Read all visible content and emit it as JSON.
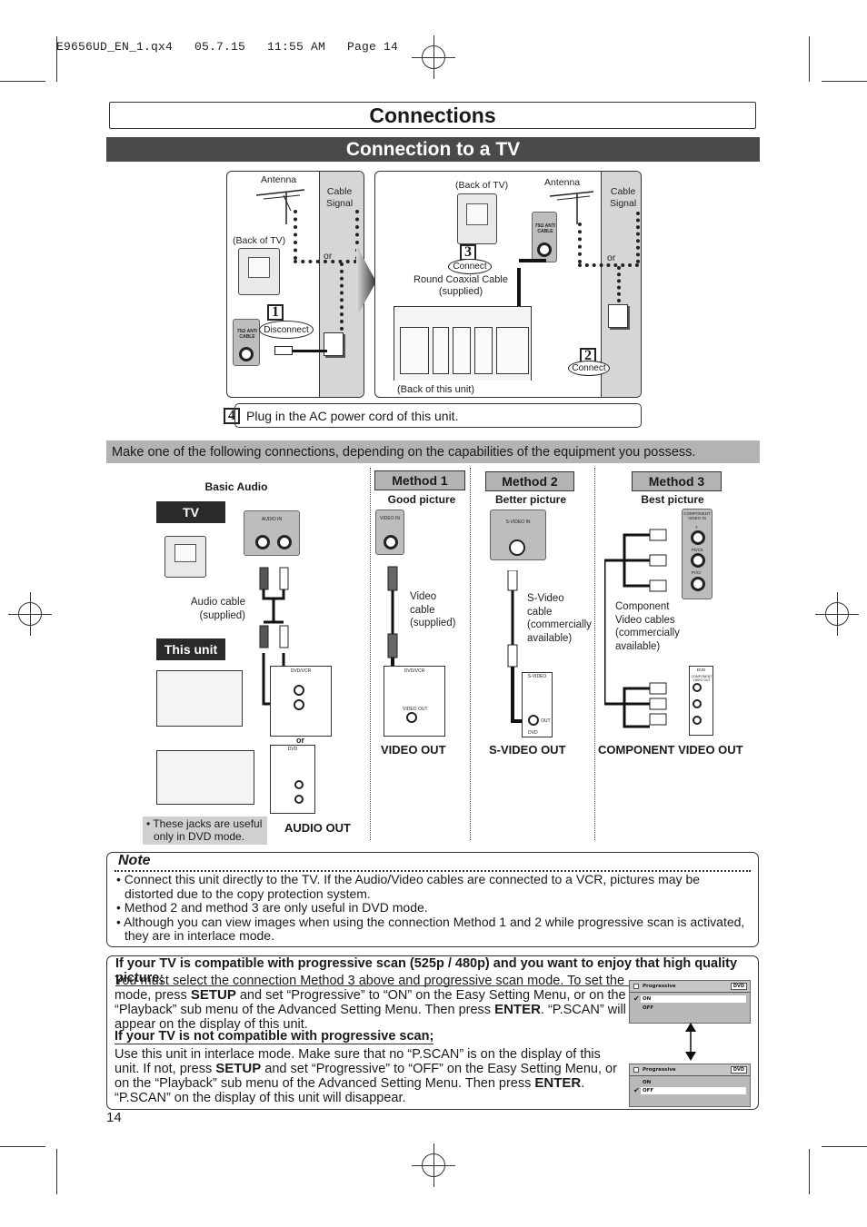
{
  "slug": "E9656UD_EN_1.qx4   05.7.15   11:55 AM   Page 14",
  "header": {
    "title": "Connections",
    "section_title": "Connection to a TV"
  },
  "diagram_top": {
    "left_panel": {
      "antenna": "Antenna",
      "cable_signal_1": "Cable",
      "cable_signal_2": "Signal",
      "back_of_tv": "(Back of TV)",
      "or": "or",
      "jack_label": "75Ω ANT/ CABLE",
      "step_number": "1",
      "step_action": "Disconnect"
    },
    "right_panel": {
      "back_of_tv": "(Back of TV)",
      "antenna": "Antenna",
      "cable_signal_1": "Cable",
      "cable_signal_2": "Signal",
      "or": "or",
      "jack_label": "75Ω ANT/ CABLE",
      "step3_number": "3",
      "step3_action": "Connect",
      "cable_name_1": "Round Coaxial Cable",
      "cable_name_2": "(supplied)",
      "step2_number": "2",
      "step2_action": "Connect",
      "back_of_unit": "(Back of this unit)"
    },
    "step4": {
      "number": "4",
      "text": "Plug in the AC power cord of this unit."
    }
  },
  "instruction": "Make one of the following connections, depending on the capabilities of the equipment you possess.",
  "basic_audio": {
    "heading": "Basic Audio",
    "tv_tag": "TV",
    "tv_jack_label": "AUDIO IN",
    "cable_caption_1": "Audio cable",
    "cable_caption_2": "(supplied)",
    "unit_tag": "This unit",
    "dvdvcr_label": "DVD/VCR",
    "audio_out_label": "AUDIO OUT",
    "or": "or",
    "dvd_label": "DVD",
    "note": "• These jacks are useful only in DVD mode.",
    "output_caption": "AUDIO OUT"
  },
  "methods": [
    {
      "label": "Method 1",
      "quality": "Good picture",
      "tv_jack": "VIDEO IN",
      "cable_caption": [
        "Video",
        "cable",
        "(supplied)"
      ],
      "unit_label": "DVD/VCR",
      "unit_jack": "VIDEO OUT",
      "output_caption": "VIDEO OUT"
    },
    {
      "label": "Method 2",
      "quality": "Better picture",
      "tv_jack": "S-VIDEO IN",
      "cable_caption": [
        "S-Video",
        "cable",
        "(commercially",
        "available)"
      ],
      "unit_label": "S-VIDEO",
      "unit_jack": "OUT",
      "unit_sub": "DVD",
      "output_caption": "S-VIDEO OUT"
    },
    {
      "label": "Method 3",
      "quality": "Best picture",
      "tv_jack": "COMPONENT VIDEO IN",
      "tv_jack_ports": [
        "Y",
        "Pb/Cb",
        "Pr/Cr"
      ],
      "cable_caption": [
        "Component",
        "Video cables",
        "(commercially",
        "available)"
      ],
      "unit_label": "DVD",
      "unit_jack": "COMPONENT VIDEO OUT",
      "output_caption": "COMPONENT VIDEO OUT"
    }
  ],
  "note": {
    "title": "Note",
    "items": [
      "Connect this unit directly to the TV. If the Audio/Video cables are connected to a VCR, pictures may be distorted due to the copy protection system.",
      "Method 2 and method 3 are only useful in DVD mode.",
      "Although you can view images when using the connection Method 1 and 2 while progressive scan is activated, they are in interlace mode."
    ]
  },
  "progressive": {
    "heading_compatible": "If your TV is compatible with progressive scan (525p / 480p) and you want to enjoy that high quality picture;",
    "para_compatible": {
      "a": "You must select the connection Method 3 above and progressive scan mode. To set the mode, press ",
      "b": "SETUP",
      "c": " and set “Progressive” to “ON” on the Easy Setting Menu, or on the “Playback” sub menu of the Advanced Setting Menu. Then press ",
      "d": "ENTER",
      "e": ". “P.SCAN” will appear on the display of this unit."
    },
    "heading_not_compatible": "If your TV is not compatible with progressive scan;",
    "para_not_compatible": {
      "a": "Use this unit in interlace mode. Make sure that no “P.SCAN” is on the display of this unit. If not, press ",
      "b": "SETUP",
      "c": " and set “Progressive” to “OFF” on the Easy Setting Menu, or on the “Playback” sub menu of the Advanced Setting Menu. Then press ",
      "d": "ENTER",
      "e": ". “P.SCAN” on the display of this unit will disappear."
    },
    "menus": [
      {
        "title": "Progressive",
        "badge": "DVD",
        "options": [
          "ON",
          "OFF"
        ],
        "selected": "ON"
      },
      {
        "title": "Progressive",
        "badge": "DVD",
        "options": [
          "ON",
          "OFF"
        ],
        "selected": "OFF"
      }
    ]
  },
  "page_number": "14"
}
